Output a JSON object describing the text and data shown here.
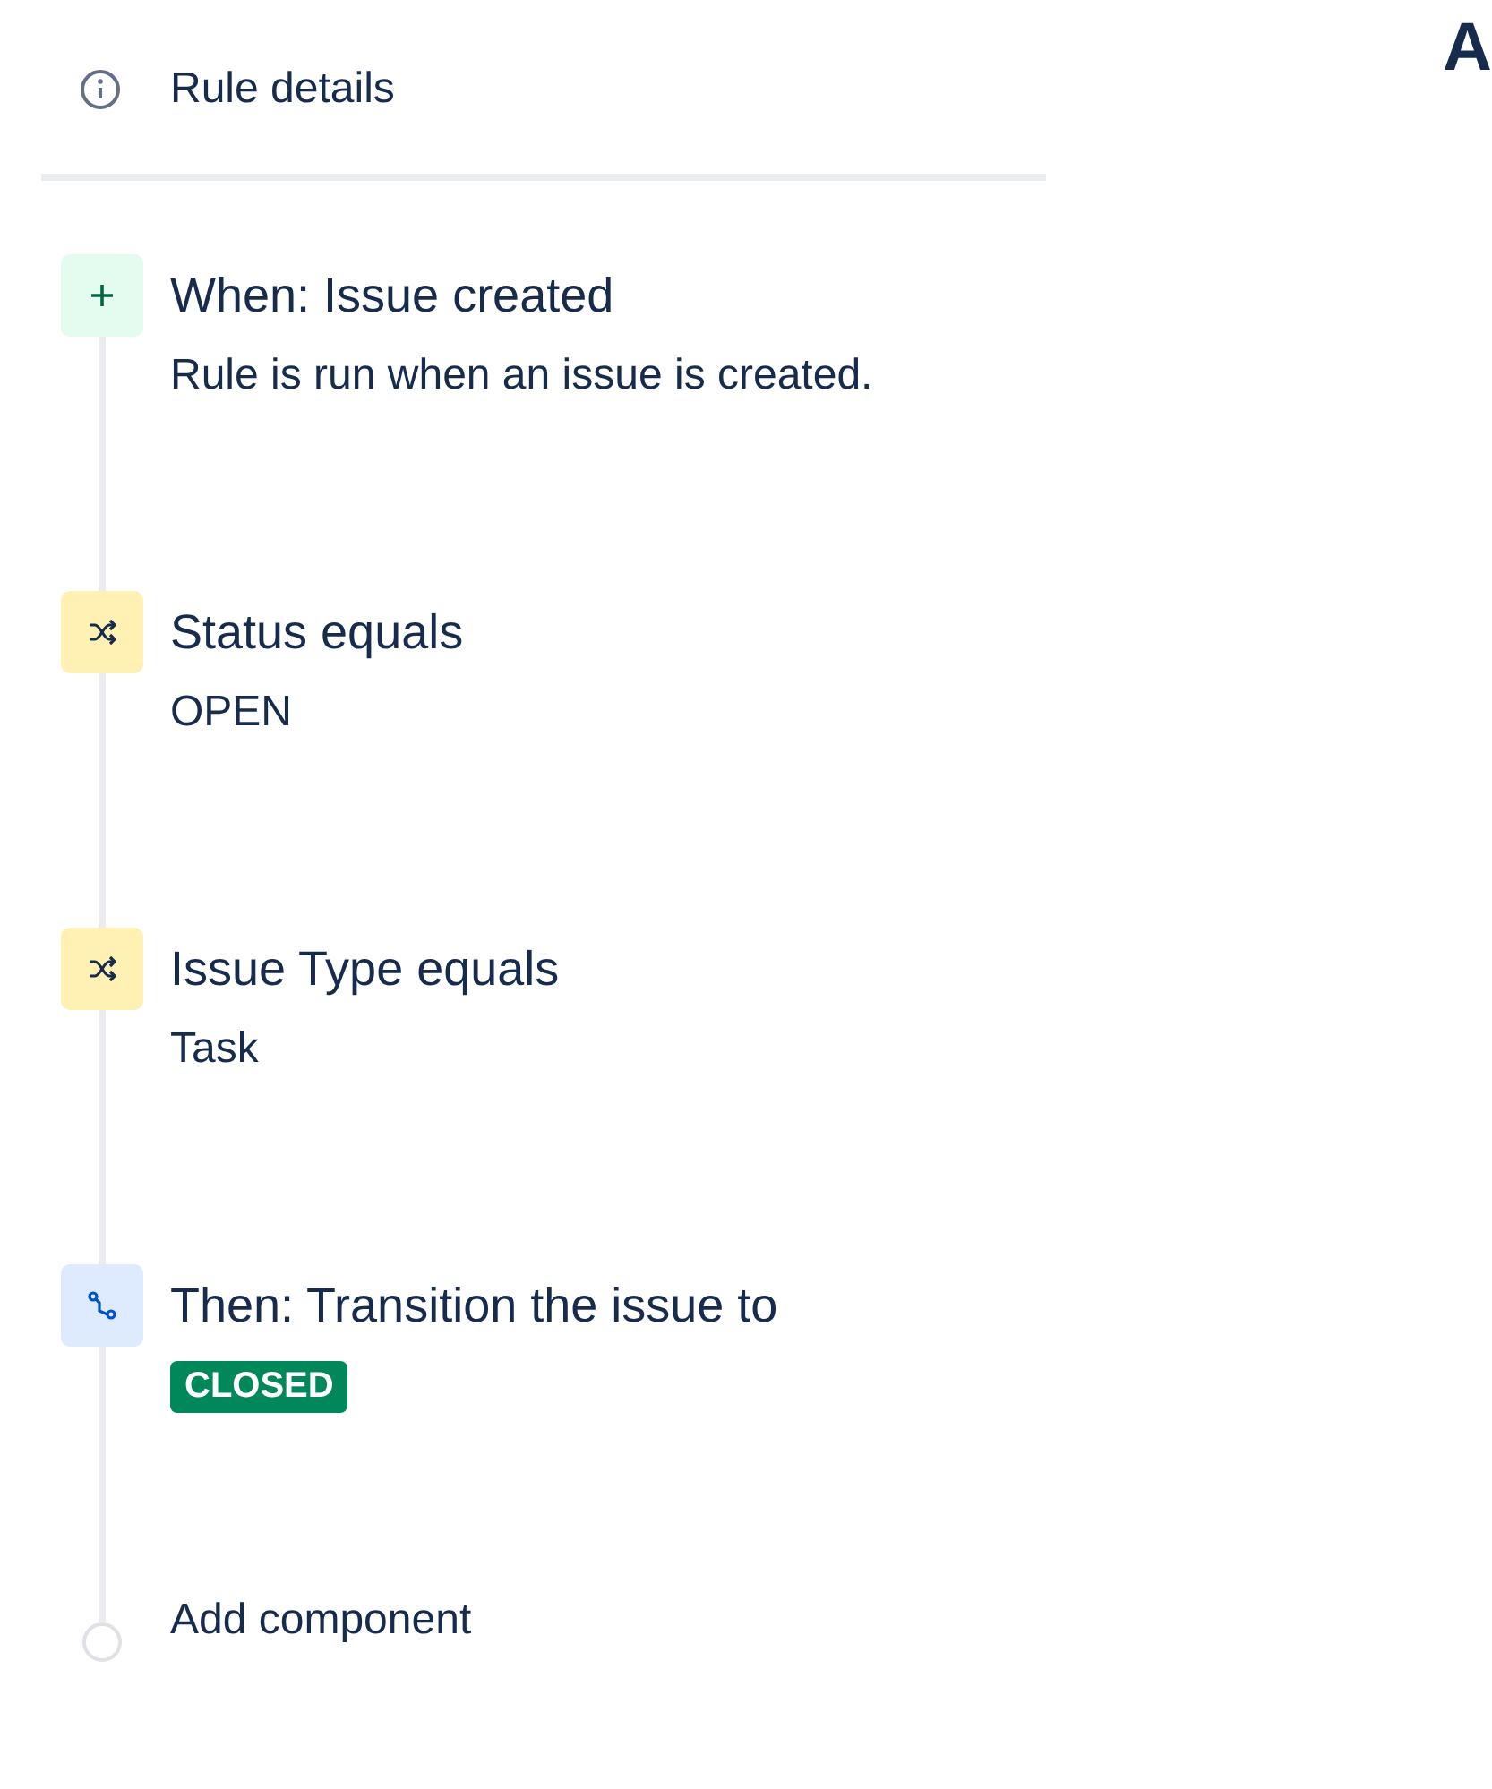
{
  "rule_panel": {
    "details_label": "Rule details",
    "steps": [
      {
        "kind": "trigger",
        "title": "When: Issue created",
        "detail": {
          "kind": "text",
          "text": "Rule is run when an issue is created."
        }
      },
      {
        "kind": "condition",
        "title": "Status equals",
        "detail": {
          "kind": "text",
          "text": "OPEN"
        }
      },
      {
        "kind": "condition",
        "title": "Issue Type equals",
        "detail": {
          "kind": "text",
          "text": "Task"
        }
      },
      {
        "kind": "action",
        "title": "Then: Transition the issue to",
        "detail": {
          "kind": "lozenge",
          "text": "CLOSED"
        }
      }
    ],
    "add_component": "Add component"
  },
  "heading": "A"
}
